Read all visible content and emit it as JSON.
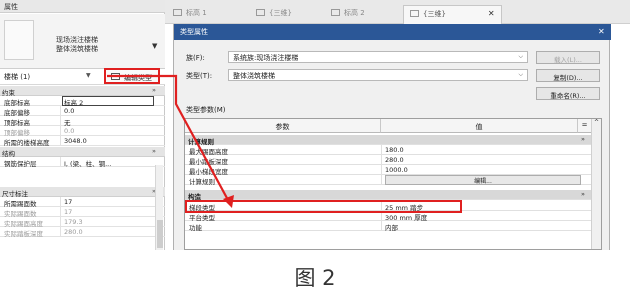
{
  "properties_panel": {
    "title": "属性",
    "type_name": "现场浇注楼梯\n整体浇筑楼梯",
    "selector_label": "楼梯 (1)",
    "edit_type_label": "编辑类型",
    "groups": [
      {
        "name": "约束",
        "rows": [
          {
            "key": "底部标高",
            "value": "标高 2"
          },
          {
            "key": "底部偏移",
            "value": "0.0"
          },
          {
            "key": "顶部标高",
            "value": "无"
          },
          {
            "key": "顶部偏移",
            "value": "0.0"
          },
          {
            "key": "所需的楼梯高度",
            "value": "3048.0"
          }
        ]
      },
      {
        "name": "结构",
        "rows": [
          {
            "key": "钢筋保护层",
            "value": "I, (梁、柱、钢..."
          }
        ]
      },
      {
        "name": "尺寸标注",
        "rows": [
          {
            "key": "所需踢面数",
            "value": "17"
          },
          {
            "key": "实际踢面数",
            "value": "17"
          },
          {
            "key": "实际踢面高度",
            "value": "179.3"
          },
          {
            "key": "实际踏板深度",
            "value": "280.0"
          }
        ]
      }
    ]
  },
  "tabs": [
    {
      "label": "标高 1"
    },
    {
      "label": "{三维}"
    },
    {
      "label": "标高 2"
    },
    {
      "label": "{三维}"
    }
  ],
  "dialog": {
    "title": "类型属性",
    "family_label": "族(F):",
    "family_value": "系统族:现场浇注楼梯",
    "type_label": "类型(T):",
    "type_value": "整体浇筑楼梯",
    "load_button": "载入(L)...",
    "duplicate_button": "复制(D)...",
    "rename_button": "重命名(R)...",
    "type_params_label": "类型参数(M)",
    "table": {
      "col_param": "参数",
      "col_value": "值",
      "col_extra": "=",
      "rows": [
        {
          "key": "计算规则",
          "value": "",
          "group": true
        },
        {
          "key": "最大踢面高度",
          "value": "180.0"
        },
        {
          "key": "最小踏板深度",
          "value": "280.0"
        },
        {
          "key": "最小梯段宽度",
          "value": "1000.0"
        },
        {
          "key": "计算规则",
          "value": "编辑..."
        },
        {
          "key": "构造",
          "value": "",
          "group": true
        },
        {
          "key": "梯段类型",
          "value": "25 mm 踏步"
        },
        {
          "key": "平台类型",
          "value": "300 mm 厚度"
        },
        {
          "key": "功能",
          "value": "内部"
        }
      ]
    }
  },
  "caption": "图 2"
}
